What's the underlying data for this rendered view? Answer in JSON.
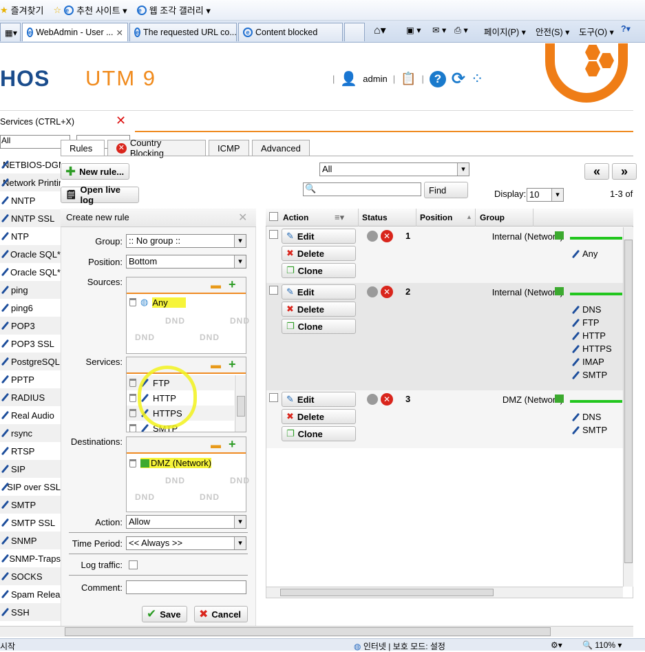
{
  "browser": {
    "favorites_label": "즐겨찾기",
    "fav_links": [
      "추천 사이트 ▾",
      "웹 조각 갤러리 ▾"
    ],
    "tabs": [
      "WebAdmin - User ...",
      "The requested URL co...",
      "Content blocked"
    ],
    "commands": [
      "페이지(P) ▾",
      "안전(S) ▾",
      "도구(O) ▾"
    ],
    "status_zone": "인터넷 | 보호 모드: 설정",
    "zoom": "110%",
    "start_label": "시작"
  },
  "header": {
    "logo_left": "HOS",
    "logo_product": "UTM 9",
    "user": "admin"
  },
  "services": {
    "title": "Services (CTRL+X)",
    "filter": "All",
    "items": [
      "NETBIOS-DGM",
      "Network Printing",
      "NNTP",
      "NNTP SSL",
      "NTP",
      "Oracle SQL*",
      "Oracle SQL*",
      "ping",
      "ping6",
      "POP3",
      "POP3 SSL",
      "PostgreSQL",
      "PPTP",
      "RADIUS",
      "Real Audio",
      "rsync",
      "RTSP",
      "SIP",
      "SIP over SSL",
      "SMTP",
      "SMTP SSL",
      "SNMP",
      "SNMP-Traps",
      "SOCKS",
      "Spam Relea",
      "SSH"
    ]
  },
  "page_tabs": [
    "Rules",
    "Country Blocking",
    "ICMP",
    "Advanced"
  ],
  "actions": {
    "new_rule": "New rule...",
    "open_live_log": "Open live log"
  },
  "create_rule": {
    "title": "Create new rule",
    "group_label": "Group:",
    "group_value": ":: No group ::",
    "position_label": "Position:",
    "position_value": "Bottom",
    "sources_label": "Sources:",
    "sources": [
      "Any"
    ],
    "services_label": "Services:",
    "services": [
      "FTP",
      "HTTP",
      "HTTPS",
      "SMTP"
    ],
    "destinations_label": "Destinations:",
    "destinations": [
      "DMZ (Network)"
    ],
    "dnd": "DND",
    "action_label": "Action:",
    "action_value": "Allow",
    "time_label": "Time Period:",
    "time_value": "<< Always >>",
    "log_label": "Log traffic:",
    "comment_label": "Comment:",
    "save": "Save",
    "cancel": "Cancel"
  },
  "list": {
    "filter": "All",
    "search_button": "Find",
    "display_label": "Display:",
    "display_value": "10",
    "count": "1-3 of",
    "prev": "«",
    "next": "»",
    "columns": [
      "Action",
      "Status",
      "Position",
      "Group"
    ],
    "button_labels": {
      "edit": "Edit",
      "delete": "Delete",
      "clone": "Clone"
    },
    "rules": [
      {
        "position": "1",
        "source": "Internal (Network)",
        "services": [
          "Any"
        ]
      },
      {
        "position": "2",
        "source": "Internal (Network)",
        "services": [
          "DNS",
          "FTP",
          "HTTP",
          "HTTPS",
          "IMAP",
          "SMTP"
        ]
      },
      {
        "position": "3",
        "source": "DMZ (Network)",
        "services": [
          "DNS",
          "SMTP"
        ]
      }
    ]
  },
  "colors": {
    "accent": "#ef7d16",
    "brand_blue": "#1a4c8c",
    "highlight": "#f6f43a",
    "ok_green": "#22c61e",
    "error_red": "#d9251c"
  }
}
